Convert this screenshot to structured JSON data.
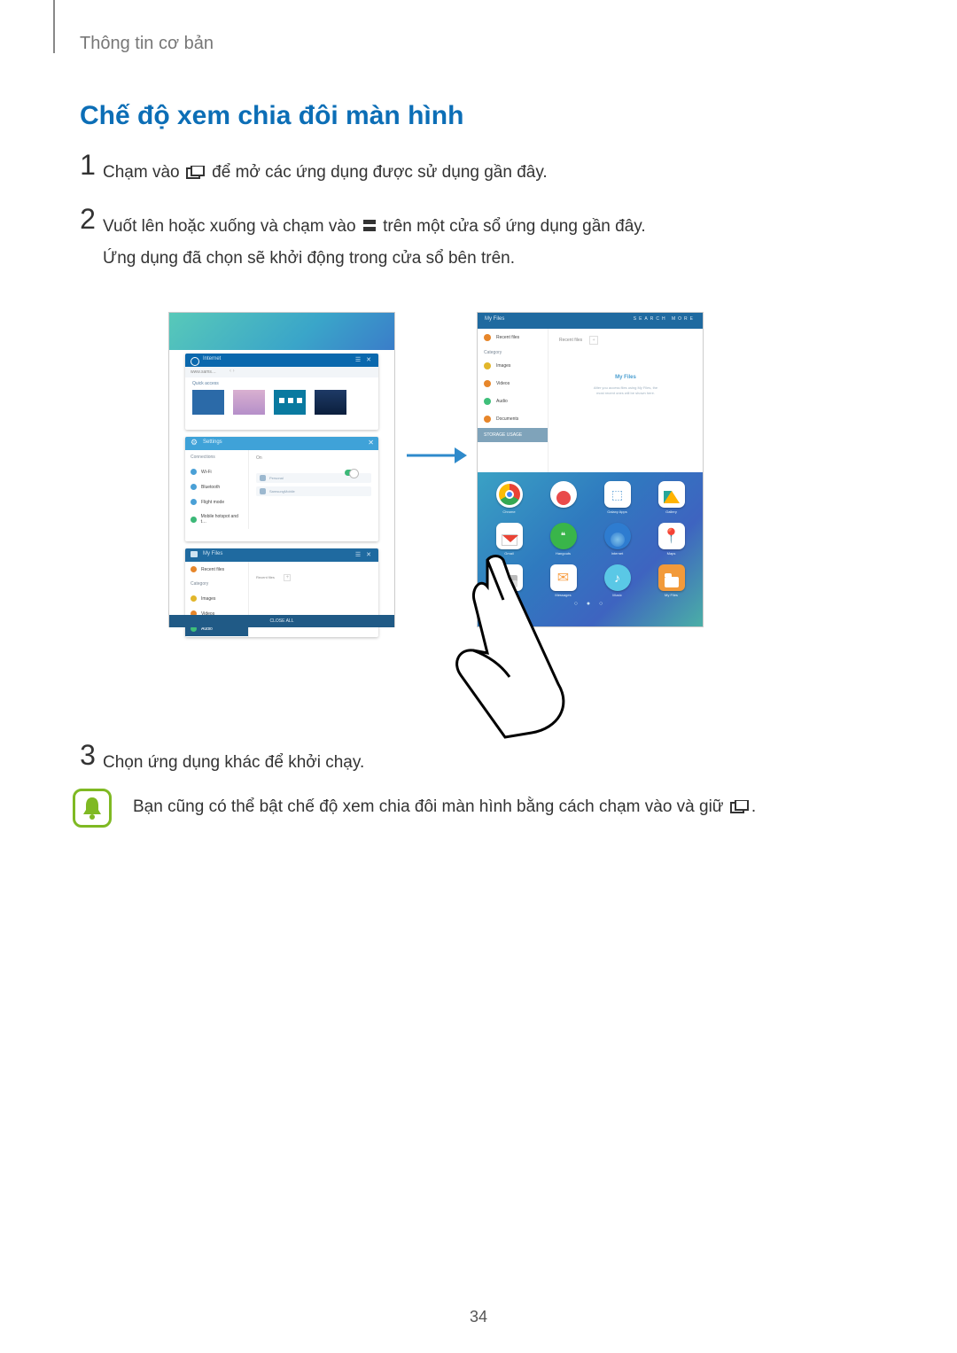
{
  "header": {
    "section_label": "Thông tin cơ bản"
  },
  "title": "Chế độ xem chia đôi màn hình",
  "steps": {
    "s1": {
      "num": "1",
      "pre": "Chạm vào ",
      "post": " để mở các ứng dụng được sử dụng gần đây."
    },
    "s2": {
      "num": "2",
      "line1_pre": "Vuốt lên hoặc xuống và chạm vào ",
      "line1_post": " trên một cửa sổ ứng dụng gần đây.",
      "line2": "Ứng dụng đã chọn sẽ khởi động trong cửa sổ bên trên."
    },
    "s3": {
      "num": "3",
      "text": "Chọn ứng dụng khác để khởi chạy."
    }
  },
  "note": {
    "pre": "Bạn cũng có thể bật chế độ xem chia đôi màn hình bằng cách chạm vào và giữ ",
    "post": "."
  },
  "page_number": "34",
  "figure": {
    "left_tablet": {
      "card_internet": {
        "title": "Internet",
        "close": "☰  ✕",
        "address": "www.sams…",
        "quick_access": "Quick access"
      },
      "card_settings": {
        "title": "Settings",
        "close": "✕",
        "section": "Connections",
        "items": [
          "Wi-Fi",
          "Bluetooth",
          "Flight mode",
          "Mobile hotspot and t…"
        ],
        "toggle": "On",
        "lines": [
          "Personal",
          "SamsungMobile"
        ]
      },
      "card_files": {
        "title": "My Files",
        "close": "☰  ✕",
        "items": [
          "Recent files"
        ],
        "category": "Category",
        "cats": [
          "Images",
          "Videos",
          "Audio"
        ],
        "tab": "Recent files",
        "plus": "+",
        "bottom": "CLOSE ALL"
      }
    },
    "right_tablet": {
      "top": {
        "title": "My Files",
        "right": "SEARCH    MORE",
        "items": [
          "Recent files"
        ],
        "category": "Category",
        "cats": [
          "Images",
          "Videos",
          "Audio",
          "Documents"
        ],
        "storage": "STORAGE USAGE",
        "tab": "Recent files",
        "plus": "+",
        "center1": "My Files",
        "center2a": "After you access files using My Files, the",
        "center2b": "most recent ones will be shown here."
      },
      "apps": {
        "names": [
          "Chrome",
          "",
          "Galaxy Apps",
          "Gallery",
          "Gmail",
          "Hangouts",
          "Internet",
          "Maps",
          "Memo",
          "Messages",
          "Music",
          "My Files"
        ],
        "dots": "○  ●  ○"
      }
    }
  }
}
